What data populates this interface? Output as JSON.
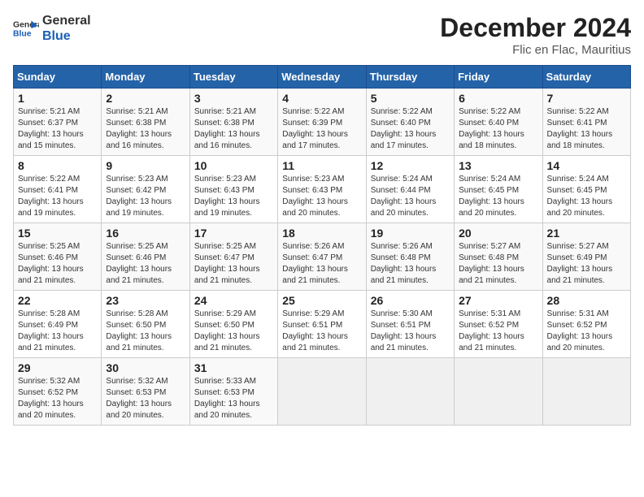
{
  "header": {
    "logo_general": "General",
    "logo_blue": "Blue",
    "month_title": "December 2024",
    "location": "Flic en Flac, Mauritius"
  },
  "weekdays": [
    "Sunday",
    "Monday",
    "Tuesday",
    "Wednesday",
    "Thursday",
    "Friday",
    "Saturday"
  ],
  "weeks": [
    [
      {
        "day": 1,
        "sunrise": "5:21 AM",
        "sunset": "6:37 PM",
        "daylight": "13 hours and 15 minutes."
      },
      {
        "day": 2,
        "sunrise": "5:21 AM",
        "sunset": "6:38 PM",
        "daylight": "13 hours and 16 minutes."
      },
      {
        "day": 3,
        "sunrise": "5:21 AM",
        "sunset": "6:38 PM",
        "daylight": "13 hours and 16 minutes."
      },
      {
        "day": 4,
        "sunrise": "5:22 AM",
        "sunset": "6:39 PM",
        "daylight": "13 hours and 17 minutes."
      },
      {
        "day": 5,
        "sunrise": "5:22 AM",
        "sunset": "6:40 PM",
        "daylight": "13 hours and 17 minutes."
      },
      {
        "day": 6,
        "sunrise": "5:22 AM",
        "sunset": "6:40 PM",
        "daylight": "13 hours and 18 minutes."
      },
      {
        "day": 7,
        "sunrise": "5:22 AM",
        "sunset": "6:41 PM",
        "daylight": "13 hours and 18 minutes."
      }
    ],
    [
      {
        "day": 8,
        "sunrise": "5:22 AM",
        "sunset": "6:41 PM",
        "daylight": "13 hours and 19 minutes."
      },
      {
        "day": 9,
        "sunrise": "5:23 AM",
        "sunset": "6:42 PM",
        "daylight": "13 hours and 19 minutes."
      },
      {
        "day": 10,
        "sunrise": "5:23 AM",
        "sunset": "6:43 PM",
        "daylight": "13 hours and 19 minutes."
      },
      {
        "day": 11,
        "sunrise": "5:23 AM",
        "sunset": "6:43 PM",
        "daylight": "13 hours and 20 minutes."
      },
      {
        "day": 12,
        "sunrise": "5:24 AM",
        "sunset": "6:44 PM",
        "daylight": "13 hours and 20 minutes."
      },
      {
        "day": 13,
        "sunrise": "5:24 AM",
        "sunset": "6:45 PM",
        "daylight": "13 hours and 20 minutes."
      },
      {
        "day": 14,
        "sunrise": "5:24 AM",
        "sunset": "6:45 PM",
        "daylight": "13 hours and 20 minutes."
      }
    ],
    [
      {
        "day": 15,
        "sunrise": "5:25 AM",
        "sunset": "6:46 PM",
        "daylight": "13 hours and 21 minutes."
      },
      {
        "day": 16,
        "sunrise": "5:25 AM",
        "sunset": "6:46 PM",
        "daylight": "13 hours and 21 minutes."
      },
      {
        "day": 17,
        "sunrise": "5:25 AM",
        "sunset": "6:47 PM",
        "daylight": "13 hours and 21 minutes."
      },
      {
        "day": 18,
        "sunrise": "5:26 AM",
        "sunset": "6:47 PM",
        "daylight": "13 hours and 21 minutes."
      },
      {
        "day": 19,
        "sunrise": "5:26 AM",
        "sunset": "6:48 PM",
        "daylight": "13 hours and 21 minutes."
      },
      {
        "day": 20,
        "sunrise": "5:27 AM",
        "sunset": "6:48 PM",
        "daylight": "13 hours and 21 minutes."
      },
      {
        "day": 21,
        "sunrise": "5:27 AM",
        "sunset": "6:49 PM",
        "daylight": "13 hours and 21 minutes."
      }
    ],
    [
      {
        "day": 22,
        "sunrise": "5:28 AM",
        "sunset": "6:49 PM",
        "daylight": "13 hours and 21 minutes."
      },
      {
        "day": 23,
        "sunrise": "5:28 AM",
        "sunset": "6:50 PM",
        "daylight": "13 hours and 21 minutes."
      },
      {
        "day": 24,
        "sunrise": "5:29 AM",
        "sunset": "6:50 PM",
        "daylight": "13 hours and 21 minutes."
      },
      {
        "day": 25,
        "sunrise": "5:29 AM",
        "sunset": "6:51 PM",
        "daylight": "13 hours and 21 minutes."
      },
      {
        "day": 26,
        "sunrise": "5:30 AM",
        "sunset": "6:51 PM",
        "daylight": "13 hours and 21 minutes."
      },
      {
        "day": 27,
        "sunrise": "5:31 AM",
        "sunset": "6:52 PM",
        "daylight": "13 hours and 21 minutes."
      },
      {
        "day": 28,
        "sunrise": "5:31 AM",
        "sunset": "6:52 PM",
        "daylight": "13 hours and 20 minutes."
      }
    ],
    [
      {
        "day": 29,
        "sunrise": "5:32 AM",
        "sunset": "6:52 PM",
        "daylight": "13 hours and 20 minutes."
      },
      {
        "day": 30,
        "sunrise": "5:32 AM",
        "sunset": "6:53 PM",
        "daylight": "13 hours and 20 minutes."
      },
      {
        "day": 31,
        "sunrise": "5:33 AM",
        "sunset": "6:53 PM",
        "daylight": "13 hours and 20 minutes."
      },
      null,
      null,
      null,
      null
    ]
  ],
  "labels": {
    "sunrise": "Sunrise:",
    "sunset": "Sunset:",
    "daylight": "Daylight:"
  }
}
